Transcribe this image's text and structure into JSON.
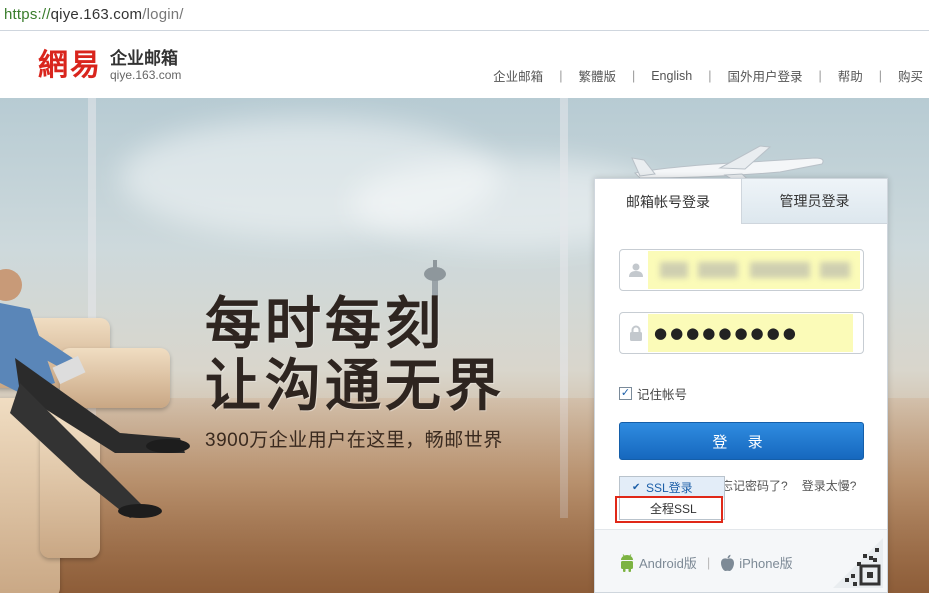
{
  "browser": {
    "scheme": "https://",
    "host": "qiye.163.com",
    "path": "/login/"
  },
  "header": {
    "logo_mark": "網易",
    "logo_title": "企业邮箱",
    "logo_sub": "qiye.163.com",
    "nav": [
      {
        "label": "企业邮箱"
      },
      {
        "label": "繁體版"
      },
      {
        "label": "English"
      },
      {
        "label": "国外用户登录"
      },
      {
        "label": "帮助"
      },
      {
        "label": "购买"
      }
    ]
  },
  "hero": {
    "line1": "每时每刻",
    "line2": "让沟通无界",
    "sub": "3900万企业用户在这里，畅邮世界"
  },
  "login": {
    "tabs": [
      {
        "label": "邮箱帐号登录",
        "active": true
      },
      {
        "label": "管理员登录",
        "active": false
      }
    ],
    "password_value": "●●●●●●●●●",
    "remember_label": "记住帐号",
    "remember_checked": true,
    "login_button": "登 录",
    "ssl_options": [
      {
        "label": "SSL登录",
        "selected": true
      },
      {
        "label": "全程SSL",
        "selected": false
      }
    ],
    "forgot_link": "忘记密码了?",
    "slow_link": "登录太慢?",
    "apps": [
      {
        "label": "Android版",
        "icon": "android-icon"
      },
      {
        "label": "iPhone版",
        "icon": "apple-icon"
      }
    ]
  },
  "colors": {
    "brand_red": "#d9251d",
    "button_blue": "#1f76cc",
    "highlight_red_box": "#e02818"
  }
}
